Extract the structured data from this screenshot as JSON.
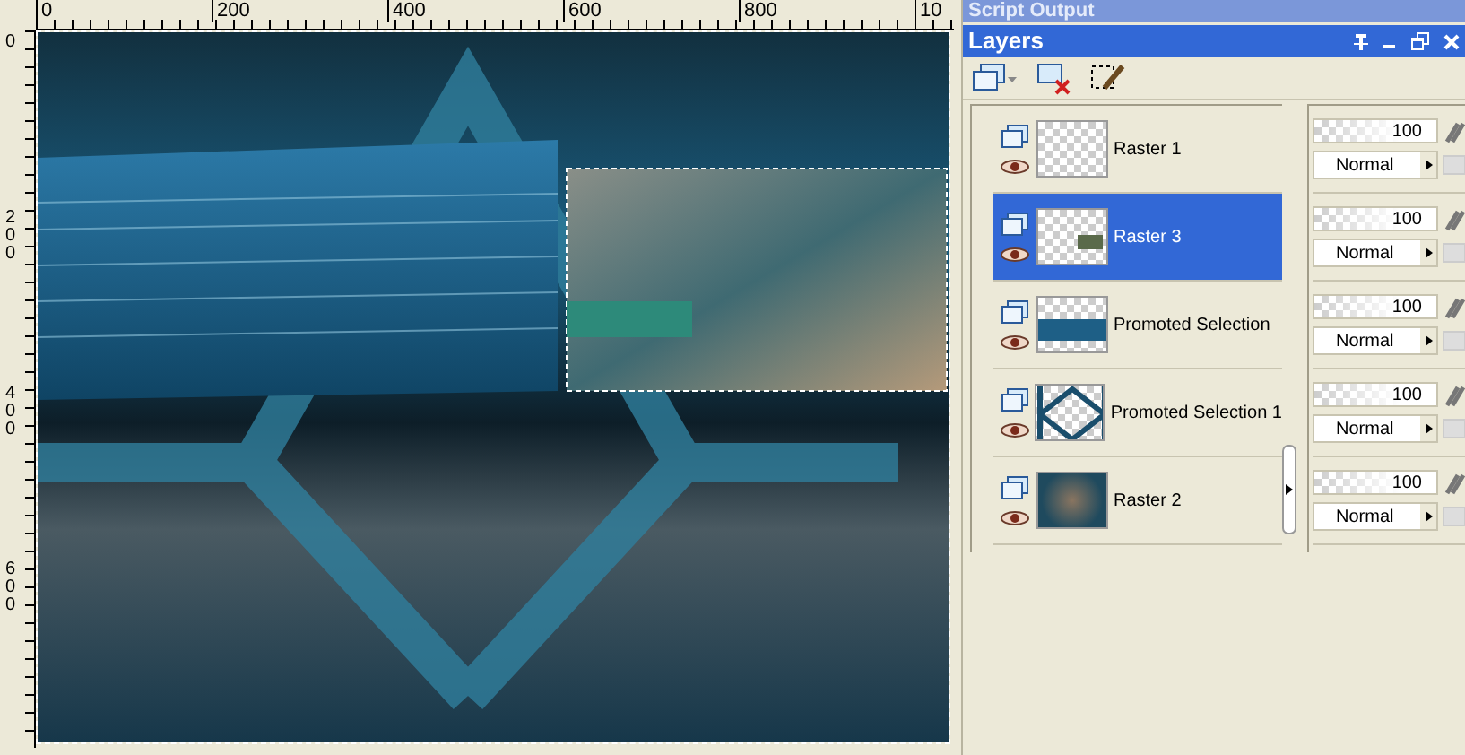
{
  "rulers": {
    "horizontal": [
      "0",
      "200",
      "400",
      "600",
      "800",
      "10"
    ],
    "vertical": [
      "0",
      "200",
      "400",
      "600"
    ]
  },
  "panels": [
    {
      "title": "Script Output",
      "kind": "collapsed"
    },
    {
      "title": "Layers",
      "kind": "open"
    }
  ],
  "layers": [
    {
      "name": "Raster 1",
      "selected": false,
      "visible": true,
      "kind": "empty",
      "opacity": "100",
      "blend_mode": "Normal"
    },
    {
      "name": "Raster 3",
      "selected": true,
      "visible": true,
      "kind": "small-photo",
      "opacity": "100",
      "blend_mode": "Normal"
    },
    {
      "name": "Promoted Selection",
      "selected": false,
      "visible": true,
      "kind": "band",
      "opacity": "100",
      "blend_mode": "Normal"
    },
    {
      "name": "Promoted Selection 1",
      "selected": false,
      "visible": true,
      "kind": "lattice",
      "opacity": "100",
      "blend_mode": "Normal"
    },
    {
      "name": "Raster 2",
      "selected": false,
      "visible": true,
      "kind": "full",
      "opacity": "100",
      "blend_mode": "Normal"
    }
  ]
}
